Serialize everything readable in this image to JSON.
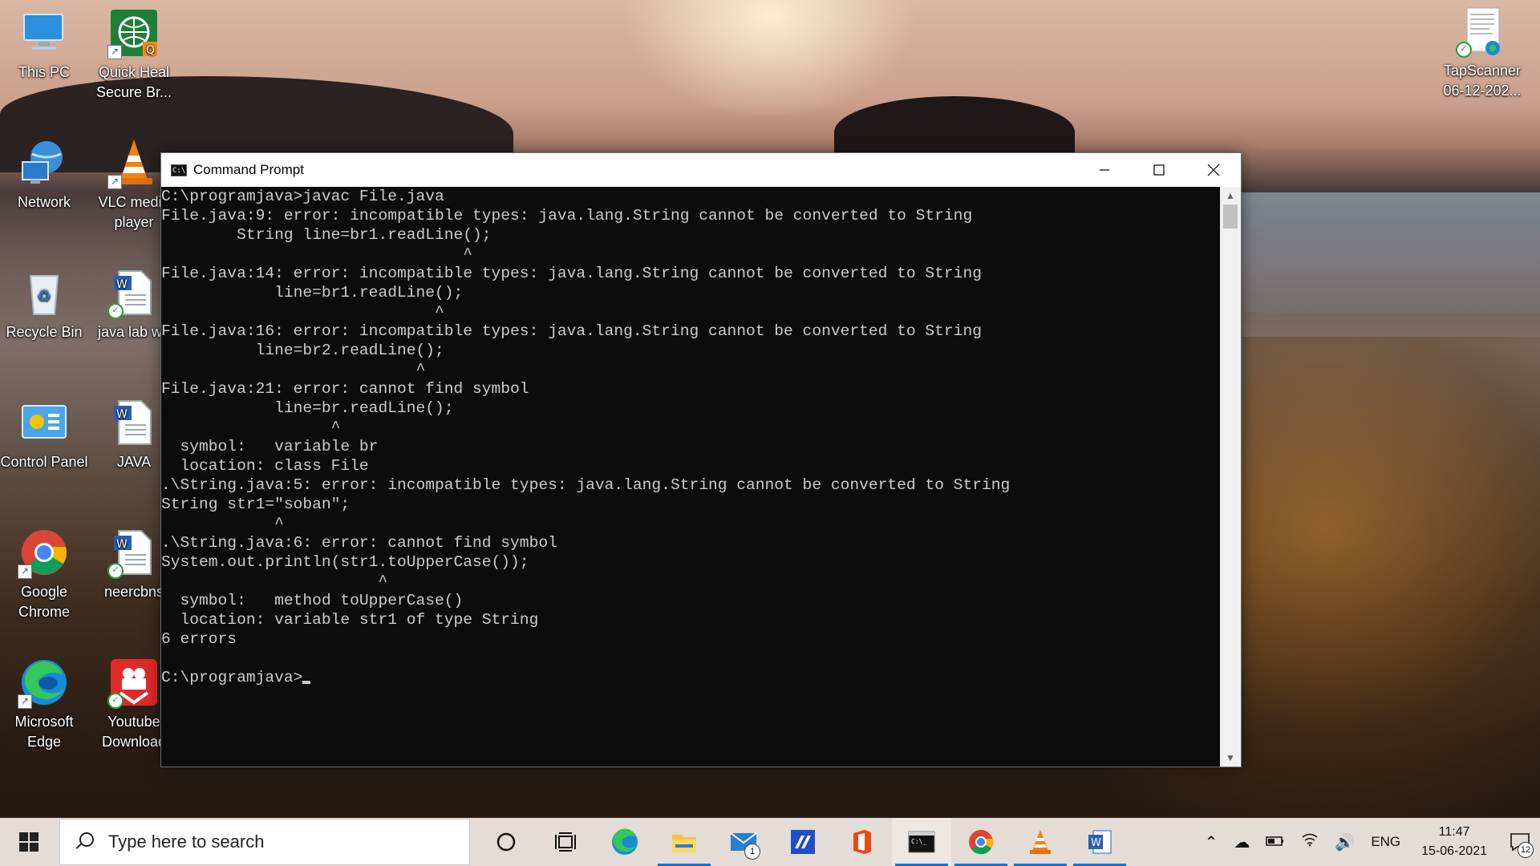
{
  "desktop": {
    "icons": [
      {
        "label": "This PC"
      },
      {
        "label": "Quick Heal Secure Br..."
      },
      {
        "label": "Network"
      },
      {
        "label": "VLC media player"
      },
      {
        "label": "Recycle Bin"
      },
      {
        "label": "java lab wo"
      },
      {
        "label": "Control Panel"
      },
      {
        "label": "JAVA"
      },
      {
        "label": "Google Chrome"
      },
      {
        "label": "neercbns"
      },
      {
        "label": "Microsoft Edge"
      },
      {
        "label": "Youtube Download"
      },
      {
        "label": "TapScanner 06-12-202..."
      }
    ]
  },
  "window": {
    "title": "Command Prompt",
    "lines": [
      "C:\\programjava>javac File.java",
      "File.java:9: error: incompatible types: java.lang.String cannot be converted to String",
      "        String line=br1.readLine();",
      "                                ^",
      "File.java:14: error: incompatible types: java.lang.String cannot be converted to String",
      "            line=br1.readLine();",
      "                             ^",
      "File.java:16: error: incompatible types: java.lang.String cannot be converted to String",
      "          line=br2.readLine();",
      "                           ^",
      "File.java:21: error: cannot find symbol",
      "            line=br.readLine();",
      "                  ^",
      "  symbol:   variable br",
      "  location: class File",
      ".\\String.java:5: error: incompatible types: java.lang.String cannot be converted to String",
      "String str1=\"soban\";",
      "            ^",
      ".\\String.java:6: error: cannot find symbol",
      "System.out.println(str1.toUpperCase());",
      "                       ^",
      "  symbol:   method toUpperCase()",
      "  location: variable str1 of type String",
      "6 errors",
      "",
      "C:\\programjava>"
    ]
  },
  "taskbar": {
    "search_placeholder": "Type here to search",
    "mail_badge": "1",
    "tray_language": "ENG",
    "time": "11:47",
    "date": "15-06-2021",
    "notification_count": "12"
  }
}
